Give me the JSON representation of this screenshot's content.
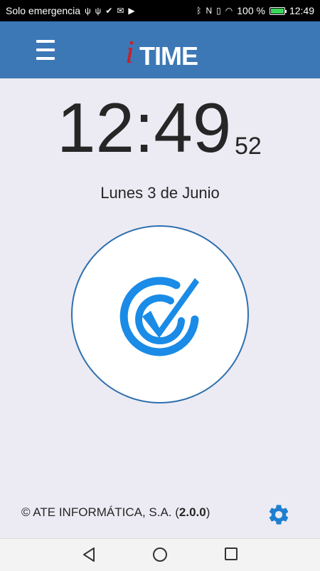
{
  "status_bar": {
    "carrier": "Solo emergencia",
    "battery_percent": "100 %",
    "battery_level": 1.0,
    "time": "12:49"
  },
  "app": {
    "logo_i": "i",
    "logo_text": "TIME",
    "brand_color": "#3c78b6"
  },
  "clock": {
    "hours_minutes": "12:49",
    "seconds": "52",
    "date": "Lunes 3 de Junio"
  },
  "check_button": {
    "icon": "check-circle-icon",
    "color": "#1a8be6"
  },
  "footer": {
    "copyright": "© ATE INFORMÁTICA, S.A. (",
    "version": "2.0.0",
    "close_paren": ")",
    "settings_icon": "gear-icon"
  },
  "nav_bar": {
    "back_icon": "back-triangle-icon",
    "home_icon": "home-circle-icon",
    "recent_icon": "recent-square-icon"
  }
}
